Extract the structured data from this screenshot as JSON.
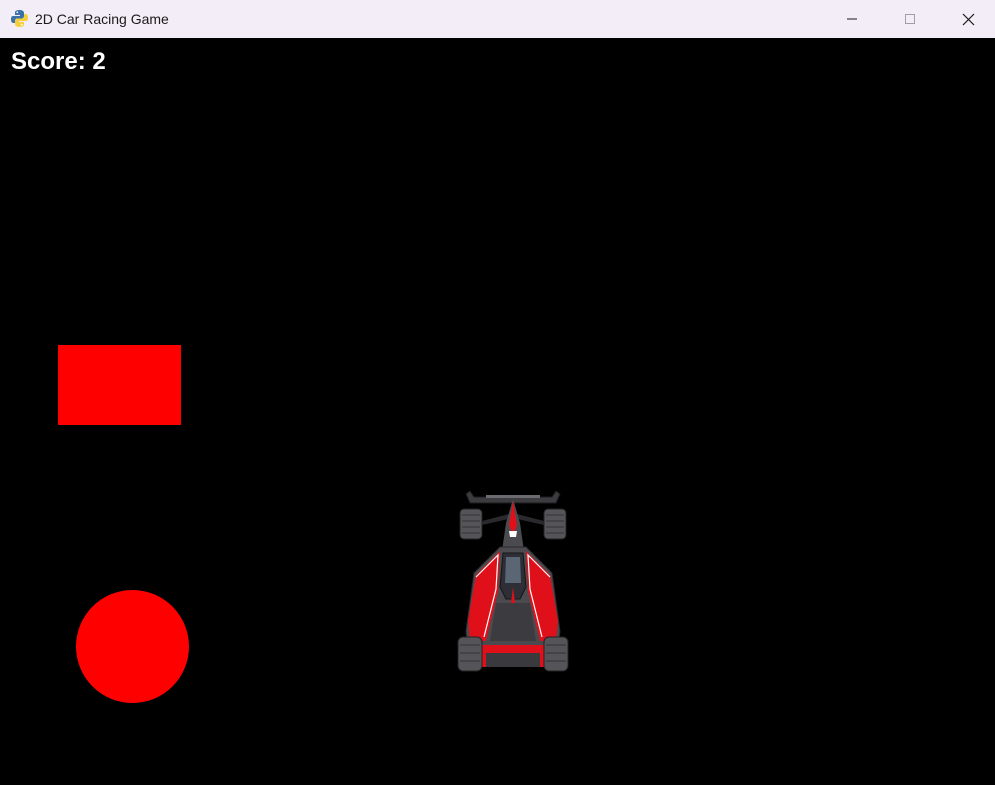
{
  "window": {
    "title": "2D Car Racing Game",
    "titlebar_bg": "#f3edf7",
    "app_icon": "python-snake-icon",
    "controls": [
      "minimize-icon",
      "maximize-icon",
      "close-icon"
    ]
  },
  "game": {
    "background": "#000000",
    "score_label": "Score: 2",
    "score_color": "#ffffff",
    "obstacles": [
      {
        "shape": "rectangle",
        "color": "#ff0000"
      },
      {
        "shape": "circle",
        "color": "#ff0000"
      }
    ],
    "player_car": {
      "type": "formula-race-car",
      "body_color": "#4a4a4f",
      "accent_color": "#e0101a"
    }
  }
}
